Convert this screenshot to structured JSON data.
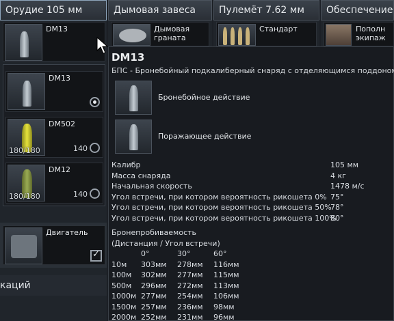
{
  "tabs": [
    {
      "label": "Орудие 105 мм"
    },
    {
      "label": "Дымовая завеса"
    },
    {
      "label": "Пулемёт 7.62 мм"
    },
    {
      "label": "Обеспечение"
    }
  ],
  "slots": {
    "gun": {
      "label": "DM13"
    },
    "smoke": {
      "label": "Дымовая\nграната"
    },
    "mg": {
      "label": "Стандарт"
    },
    "crew": {
      "label": "Пополн\nэкипаж"
    }
  },
  "ammo_list": [
    {
      "label": "DM13",
      "count": "",
      "reserve": "",
      "selected": true
    },
    {
      "label": "DM502",
      "count": "180/180",
      "reserve": "140",
      "selected": false
    },
    {
      "label": "DM12",
      "count": "180/180",
      "reserve": "140",
      "selected": false
    }
  ],
  "engine": {
    "label": "Двигатель",
    "checked": true
  },
  "bottom_left_label": "каций",
  "tooltip": {
    "title": "DM13",
    "subtitle": "БПС - Бронебойный подкалиберный снаряд с отделяющимся поддоном",
    "features": [
      "Бронебойное действие",
      "Поражающее действие"
    ],
    "stats": [
      {
        "k": "Калибр",
        "v": "105 мм"
      },
      {
        "k": "Масса снаряда",
        "v": "4 кг"
      },
      {
        "k": "Начальная скорость",
        "v": "1478 м/с"
      },
      {
        "k": "Угол встречи, при котором вероятность рикошета 0%",
        "v": "75°"
      },
      {
        "k": "Угол встречи, при котором вероятность рикошета 50%",
        "v": "78°"
      },
      {
        "k": "Угол встречи, при котором вероятность рикошета 100%",
        "v": "80°"
      }
    ],
    "penetration_title": "Бронепробиваемость",
    "penetration_sub": "(Дистанция / Угол встречи)",
    "penetration_header": [
      "",
      "0°",
      "30°",
      "60°"
    ],
    "penetration_rows": [
      [
        "10м",
        "303мм",
        "278мм",
        "116мм"
      ],
      [
        "100м",
        "302мм",
        "277мм",
        "115мм"
      ],
      [
        "500м",
        "296мм",
        "272мм",
        "113мм"
      ],
      [
        "1000м",
        "277мм",
        "254мм",
        "106мм"
      ],
      [
        "1500м",
        "257мм",
        "236мм",
        "98мм"
      ],
      [
        "2000м",
        "252мм",
        "231мм",
        "96мм"
      ]
    ]
  },
  "colors": {
    "accent": "#8fa6bd",
    "panel": "#181b20"
  }
}
